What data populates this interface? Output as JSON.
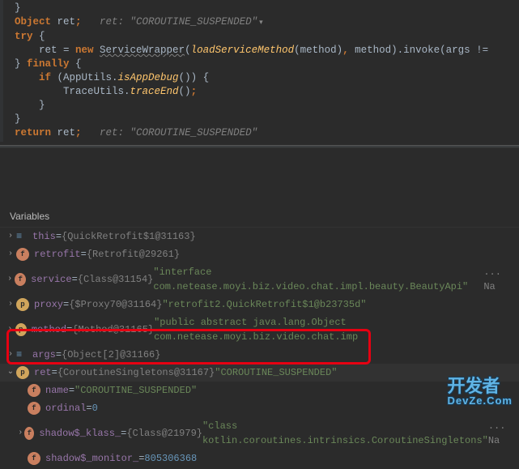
{
  "code": {
    "l1a": "}",
    "l2a": "Object ",
    "l2b": "ret",
    "l2c": ";   ",
    "l2hint": "ret: \"COROUTINE_SUSPENDED\"",
    "l3a": "try ",
    "l3b": "{",
    "l4a": "    ret ",
    "l4b": "= ",
    "l4c": "new ",
    "l4d": "ServiceWrapper",
    "l4e": "(",
    "l4f": "loadServiceMethod",
    "l4g": "(method)",
    "l4h": ", ",
    "l4i": "method).invoke(args !=",
    "l5a": "} ",
    "l5b": "finally ",
    "l5c": "{",
    "l6a": "    ",
    "l6b": "if ",
    "l6c": "(AppUtils.",
    "l6d": "isAppDebug",
    "l6e": "()) {",
    "l7a": "        TraceUtils.",
    "l7b": "traceEnd",
    "l7c": "()",
    "l7d": ";",
    "l8a": "    }",
    "l9a": "}",
    "l10a": "return ",
    "l10b": "ret",
    "l10c": ";   ",
    "l10hint": "ret: \"COROUTINE_SUSPENDED\""
  },
  "panel": {
    "title": "Variables"
  },
  "vars": {
    "this_name": "this",
    "this_val": "{QuickRetrofit$1@31163}",
    "retrofit_name": "retrofit",
    "retrofit_val": "{Retrofit@29261}",
    "service_name": "service",
    "service_val": "{Class@31154} ",
    "service_str": "\"interface com.netease.moyi.biz.video.chat.impl.beauty.BeautyApi\"",
    "service_more": " ... Na",
    "proxy_name": "proxy",
    "proxy_val": "{$Proxy70@31164} ",
    "proxy_str": "\"retrofit2.QuickRetrofit$1@b23735d\"",
    "method_name": "method",
    "method_val": "{Method@31165} ",
    "method_str": "\"public abstract java.lang.Object com.netease.moyi.biz.video.chat.imp",
    "args_name": "args",
    "args_val": "{Object[2]@31166}",
    "ret_name": "ret",
    "ret_val": "{CoroutineSingletons@31167} ",
    "ret_str": "\"COROUTINE_SUSPENDED\"",
    "name_name": "name",
    "name_str": "\"COROUTINE_SUSPENDED\"",
    "ordinal_name": "ordinal",
    "ordinal_val": "0",
    "klass_name": "shadow$_klass_",
    "klass_val": "{Class@21979} ",
    "klass_str": "\"class kotlin.coroutines.intrinsics.CoroutineSingletons\"",
    "klass_more": " ... Na",
    "monitor_name": "shadow$_monitor_",
    "monitor_val": "805306368"
  },
  "watermark": {
    "main": "开发者",
    "sub": "DevZe.Com"
  }
}
